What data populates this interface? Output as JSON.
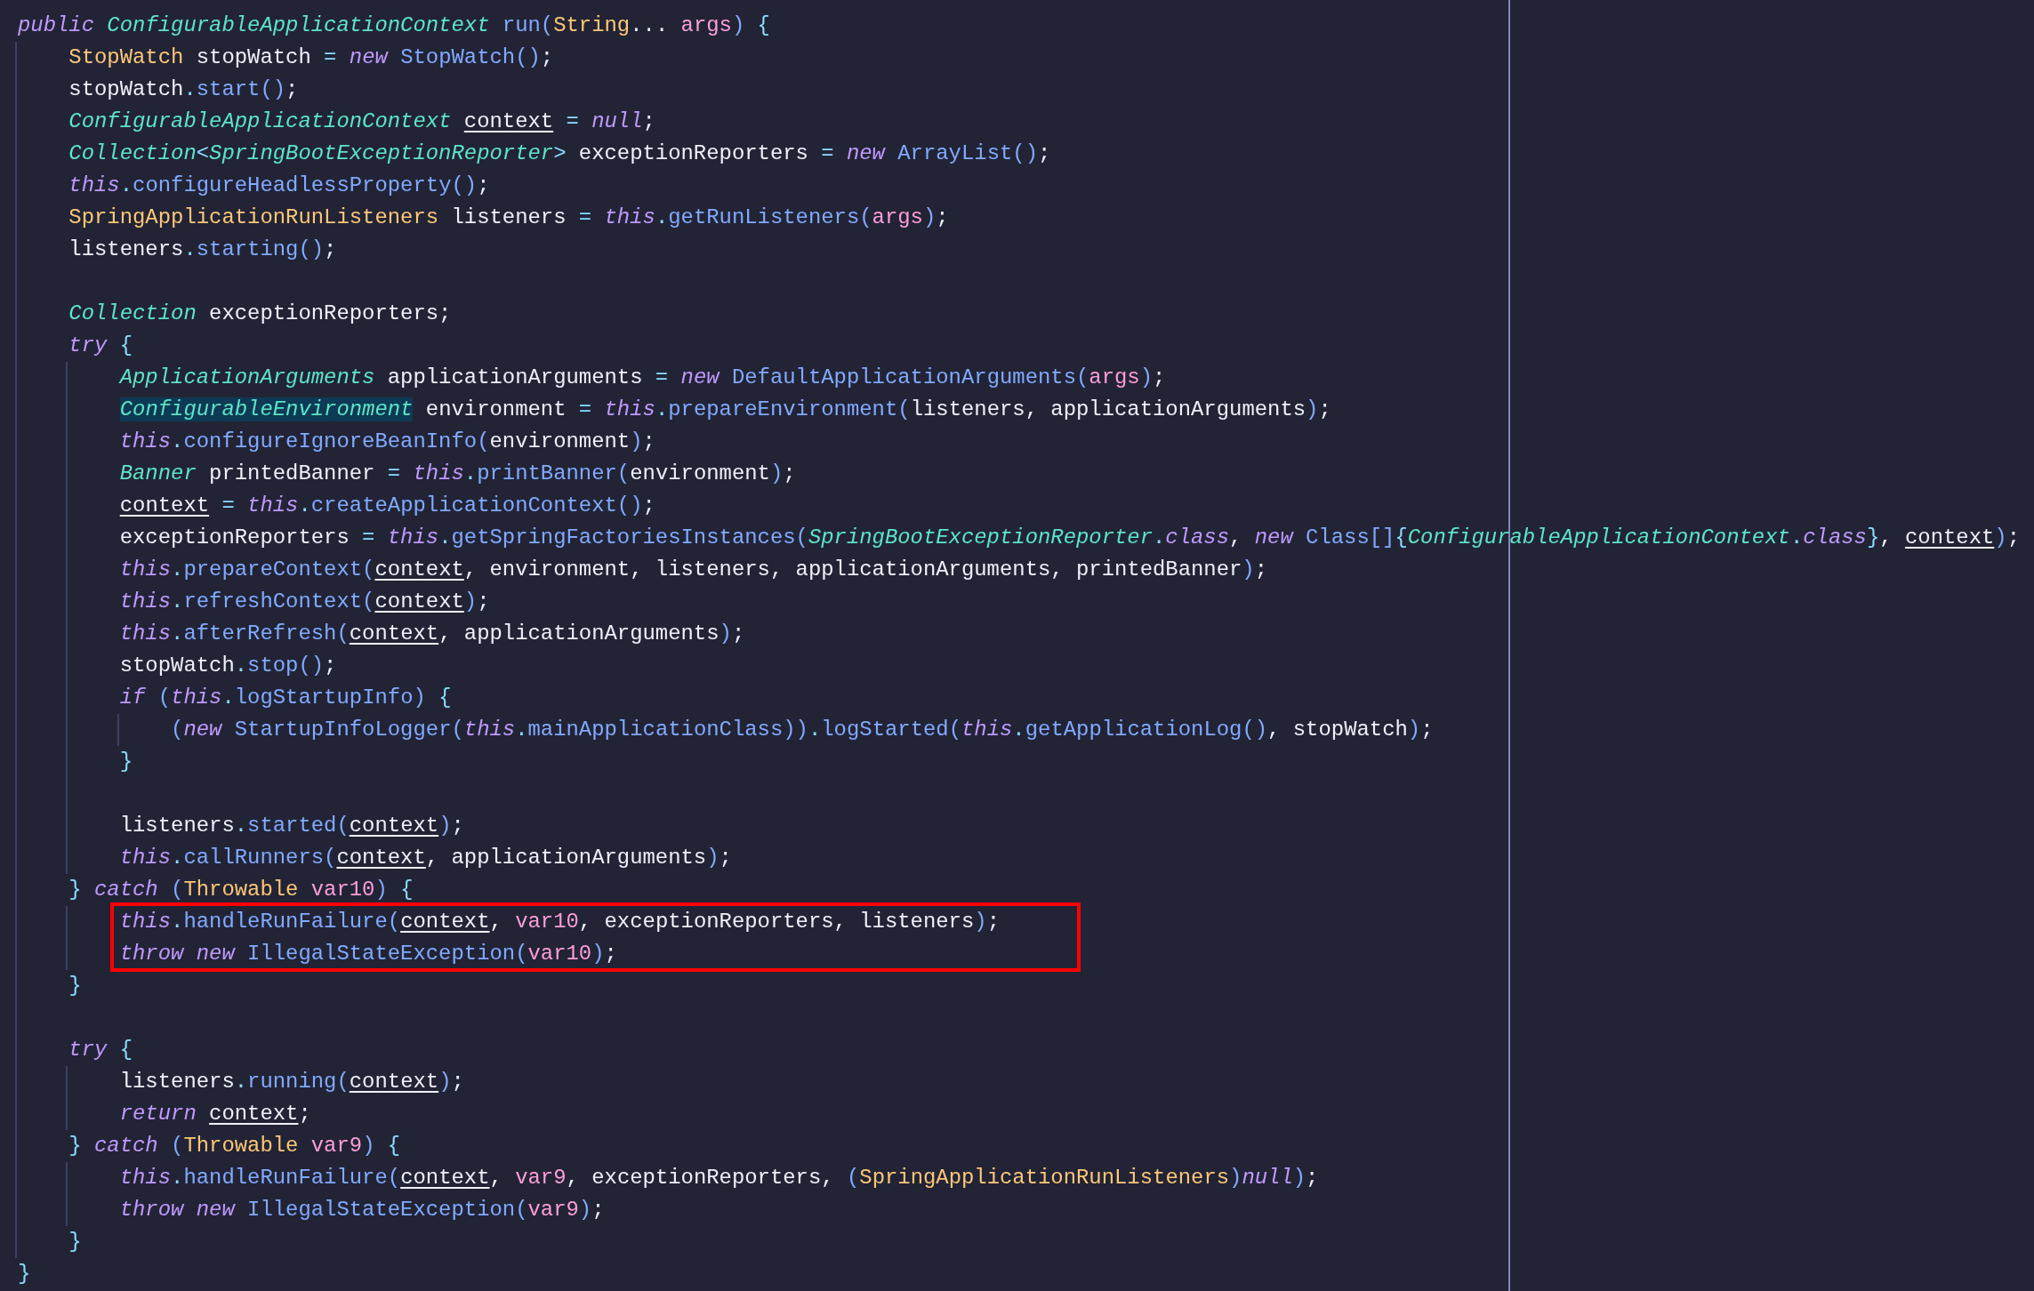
{
  "blocks": [
    {
      "boxed": false,
      "lines": [
        {
          "tokens": [
            {
              "kind": "kw",
              "text": "public"
            },
            {
              "kind": "it",
              "text": " ConfigurableApplicationContext"
            },
            {
              "kind": "fn",
              "text": " run("
            },
            {
              "kind": "type",
              "text": "String"
            },
            {
              "kind": "tx",
              "text": "... "
            },
            {
              "kind": "var",
              "text": "args"
            },
            {
              "kind": "fn",
              "text": ")"
            },
            {
              "kind": "op",
              "text": " {"
            }
          ]
        },
        {
          "tokens": [
            {
              "kind": "type",
              "text": "    StopWatch"
            },
            {
              "kind": "tx",
              "text": " stopWatch "
            },
            {
              "kind": "op",
              "text": "="
            },
            {
              "kind": "kw",
              "text": " new"
            },
            {
              "kind": "fn",
              "text": " StopWatch()"
            },
            {
              "kind": "tx",
              "text": ";"
            }
          ]
        },
        {
          "tokens": [
            {
              "kind": "tx",
              "text": "    stopWatch"
            },
            {
              "kind": "op",
              "text": "."
            },
            {
              "kind": "fn",
              "text": "start()"
            },
            {
              "kind": "tx",
              "text": ";"
            }
          ]
        },
        {
          "tokens": [
            {
              "kind": "it",
              "text": "    ConfigurableApplicationContext"
            },
            {
              "kind": "ref",
              "text": " context"
            },
            {
              "kind": "op",
              "text": " ="
            },
            {
              "kind": "kw",
              "text": " null"
            },
            {
              "kind": "tx",
              "text": ";"
            }
          ]
        },
        {
          "tokens": [
            {
              "kind": "it",
              "text": "    Collection"
            },
            {
              "kind": "op",
              "text": "<"
            },
            {
              "kind": "it",
              "text": "SpringBootExceptionReporter"
            },
            {
              "kind": "op",
              "text": ">"
            },
            {
              "kind": "tx",
              "text": " exceptionReporters "
            },
            {
              "kind": "op",
              "text": "="
            },
            {
              "kind": "kw",
              "text": " new"
            },
            {
              "kind": "fn",
              "text": " ArrayList()"
            },
            {
              "kind": "tx",
              "text": ";"
            }
          ]
        },
        {
          "tokens": [
            {
              "kind": "kw",
              "text": "    this"
            },
            {
              "kind": "op",
              "text": "."
            },
            {
              "kind": "fn",
              "text": "configureHeadlessProperty()"
            },
            {
              "kind": "tx",
              "text": ";"
            }
          ]
        },
        {
          "tokens": [
            {
              "kind": "type",
              "text": "    SpringApplicationRunListeners"
            },
            {
              "kind": "tx",
              "text": " listeners "
            },
            {
              "kind": "op",
              "text": "="
            },
            {
              "kind": "kw",
              "text": " this"
            },
            {
              "kind": "op",
              "text": "."
            },
            {
              "kind": "fn",
              "text": "getRunListeners("
            },
            {
              "kind": "var",
              "text": "args"
            },
            {
              "kind": "fn",
              "text": ")"
            },
            {
              "kind": "tx",
              "text": ";"
            }
          ]
        },
        {
          "tokens": [
            {
              "kind": "tx",
              "text": "    listeners"
            },
            {
              "kind": "op",
              "text": "."
            },
            {
              "kind": "fn",
              "text": "starting()"
            },
            {
              "kind": "tx",
              "text": ";"
            }
          ]
        },
        {
          "blank_before": true,
          "tokens": [
            {
              "kind": "it",
              "text": "    Collection"
            },
            {
              "kind": "tx",
              "text": " exceptionReporters;"
            }
          ]
        },
        {
          "tokens": [
            {
              "kind": "kw",
              "text": "    try"
            },
            {
              "kind": "op",
              "text": " {"
            }
          ]
        },
        {
          "tokens": [
            {
              "kind": "it",
              "text": "        ApplicationArguments"
            },
            {
              "kind": "tx",
              "text": " applicationArguments "
            },
            {
              "kind": "op",
              "text": "="
            },
            {
              "kind": "kw",
              "text": " new"
            },
            {
              "kind": "fn",
              "text": " DefaultApplicationArguments("
            },
            {
              "kind": "var",
              "text": "args"
            },
            {
              "kind": "fn",
              "text": ")"
            },
            {
              "kind": "tx",
              "text": ";"
            }
          ]
        },
        {
          "tokens": [
            {
              "kind": "hl",
              "text": "        ConfigurableEnvironment"
            },
            {
              "kind": "tx",
              "text": " environment "
            },
            {
              "kind": "op",
              "text": "="
            },
            {
              "kind": "kw",
              "text": " this"
            },
            {
              "kind": "op",
              "text": "."
            },
            {
              "kind": "fn",
              "text": "prepareEnvironment("
            },
            {
              "kind": "tx",
              "text": "listeners, applicationArguments"
            },
            {
              "kind": "fn",
              "text": ")"
            },
            {
              "kind": "tx",
              "text": ";"
            }
          ]
        },
        {
          "tokens": [
            {
              "kind": "kw",
              "text": "        this"
            },
            {
              "kind": "op",
              "text": "."
            },
            {
              "kind": "fn",
              "text": "configureIgnoreBeanInfo("
            },
            {
              "kind": "tx",
              "text": "environment"
            },
            {
              "kind": "fn",
              "text": ")"
            },
            {
              "kind": "tx",
              "text": ";"
            }
          ]
        },
        {
          "tokens": [
            {
              "kind": "it",
              "text": "        Banner"
            },
            {
              "kind": "tx",
              "text": " printedBanner "
            },
            {
              "kind": "op",
              "text": "="
            },
            {
              "kind": "kw",
              "text": " this"
            },
            {
              "kind": "op",
              "text": "."
            },
            {
              "kind": "fn",
              "text": "printBanner("
            },
            {
              "kind": "tx",
              "text": "environment"
            },
            {
              "kind": "fn",
              "text": ")"
            },
            {
              "kind": "tx",
              "text": ";"
            }
          ]
        },
        {
          "tokens": [
            {
              "kind": "ref",
              "text": "        context"
            },
            {
              "kind": "op",
              "text": " ="
            },
            {
              "kind": "kw",
              "text": " this"
            },
            {
              "kind": "op",
              "text": "."
            },
            {
              "kind": "fn",
              "text": "createApplicationContext()"
            },
            {
              "kind": "tx",
              "text": ";"
            }
          ]
        },
        {
          "tokens": [
            {
              "kind": "tx",
              "text": "        exceptionReporters "
            },
            {
              "kind": "op",
              "text": "="
            },
            {
              "kind": "kw",
              "text": " this"
            },
            {
              "kind": "op",
              "text": "."
            },
            {
              "kind": "fn",
              "text": "getSpringFactoriesInstances("
            },
            {
              "kind": "it",
              "text": "SpringBootExceptionReporter"
            },
            {
              "kind": "op",
              "text": "."
            },
            {
              "kind": "kw",
              "text": "class"
            },
            {
              "kind": "tx",
              "text": ","
            },
            {
              "kind": "kw",
              "text": " new"
            },
            {
              "kind": "fn",
              "text": " Class[]"
            },
            {
              "kind": "op",
              "text": "{"
            },
            {
              "kind": "it",
              "text": "ConfigurableApplicationContext"
            },
            {
              "kind": "op",
              "text": "."
            },
            {
              "kind": "kw",
              "text": "class"
            },
            {
              "kind": "op",
              "text": "}"
            },
            {
              "kind": "tx",
              "text": ", "
            },
            {
              "kind": "ref",
              "text": "context"
            },
            {
              "kind": "fn",
              "text": ")"
            },
            {
              "kind": "tx",
              "text": ";"
            }
          ]
        },
        {
          "tokens": [
            {
              "kind": "kw",
              "text": "        this"
            },
            {
              "kind": "op",
              "text": "."
            },
            {
              "kind": "fn",
              "text": "prepareContext("
            },
            {
              "kind": "ref",
              "text": "context"
            },
            {
              "kind": "tx",
              "text": ", environment, listeners, applicationArguments, printedBanner"
            },
            {
              "kind": "fn",
              "text": ")"
            },
            {
              "kind": "tx",
              "text": ";"
            }
          ]
        },
        {
          "tokens": [
            {
              "kind": "kw",
              "text": "        this"
            },
            {
              "kind": "op",
              "text": "."
            },
            {
              "kind": "fn",
              "text": "refreshContext("
            },
            {
              "kind": "ref",
              "text": "context"
            },
            {
              "kind": "fn",
              "text": ")"
            },
            {
              "kind": "tx",
              "text": ";"
            }
          ]
        },
        {
          "tokens": [
            {
              "kind": "kw",
              "text": "        this"
            },
            {
              "kind": "op",
              "text": "."
            },
            {
              "kind": "fn",
              "text": "afterRefresh("
            },
            {
              "kind": "ref",
              "text": "context"
            },
            {
              "kind": "tx",
              "text": ", applicationArguments"
            },
            {
              "kind": "fn",
              "text": ")"
            },
            {
              "kind": "tx",
              "text": ";"
            }
          ]
        },
        {
          "tokens": [
            {
              "kind": "tx",
              "text": "        stopWatch"
            },
            {
              "kind": "op",
              "text": "."
            },
            {
              "kind": "fn",
              "text": "stop()"
            },
            {
              "kind": "tx",
              "text": ";"
            }
          ]
        },
        {
          "tokens": [
            {
              "kind": "kw",
              "text": "        if"
            },
            {
              "kind": "fn",
              "text": " ("
            },
            {
              "kind": "kw",
              "text": "this"
            },
            {
              "kind": "op",
              "text": "."
            },
            {
              "kind": "fn",
              "text": "logStartupInfo)"
            },
            {
              "kind": "op",
              "text": " {"
            }
          ]
        },
        {
          "tokens": [
            {
              "kind": "fn",
              "text": "            ("
            },
            {
              "kind": "kw",
              "text": "new"
            },
            {
              "kind": "fn",
              "text": " StartupInfoLogger("
            },
            {
              "kind": "kw",
              "text": "this"
            },
            {
              "kind": "op",
              "text": "."
            },
            {
              "kind": "fn",
              "text": "mainApplicationClass))"
            },
            {
              "kind": "op",
              "text": "."
            },
            {
              "kind": "fn",
              "text": "logStarted("
            },
            {
              "kind": "kw",
              "text": "this"
            },
            {
              "kind": "op",
              "text": "."
            },
            {
              "kind": "fn",
              "text": "getApplicationLog()"
            },
            {
              "kind": "tx",
              "text": ", stopWatch"
            },
            {
              "kind": "fn",
              "text": ")"
            },
            {
              "kind": "tx",
              "text": ";"
            }
          ]
        },
        {
          "tokens": [
            {
              "kind": "op",
              "text": "        }"
            }
          ]
        },
        {
          "blank_before": true,
          "tokens": [
            {
              "kind": "tx",
              "text": "        listeners"
            },
            {
              "kind": "op",
              "text": "."
            },
            {
              "kind": "fn",
              "text": "started("
            },
            {
              "kind": "ref",
              "text": "context"
            },
            {
              "kind": "fn",
              "text": ")"
            },
            {
              "kind": "tx",
              "text": ";"
            }
          ]
        },
        {
          "tokens": [
            {
              "kind": "kw",
              "text": "        this"
            },
            {
              "kind": "op",
              "text": "."
            },
            {
              "kind": "fn",
              "text": "callRunners("
            },
            {
              "kind": "ref",
              "text": "context"
            },
            {
              "kind": "tx",
              "text": ", applicationArguments"
            },
            {
              "kind": "fn",
              "text": ")"
            },
            {
              "kind": "tx",
              "text": ";"
            }
          ]
        },
        {
          "tokens": [
            {
              "kind": "op",
              "text": "    }"
            },
            {
              "kind": "kw",
              "text": " catch"
            },
            {
              "kind": "fn",
              "text": " ("
            },
            {
              "kind": "type",
              "text": "Throwable"
            },
            {
              "kind": "var",
              "text": " var10"
            },
            {
              "kind": "fn",
              "text": ")"
            },
            {
              "kind": "op",
              "text": " {"
            }
          ]
        }
      ]
    },
    {
      "boxed": true,
      "lines": [
        {
          "tokens": [
            {
              "kind": "kw",
              "text": "        this"
            },
            {
              "kind": "op",
              "text": "."
            },
            {
              "kind": "fn",
              "text": "handleRunFailure("
            },
            {
              "kind": "ref",
              "text": "context"
            },
            {
              "kind": "tx",
              "text": ", "
            },
            {
              "kind": "var",
              "text": "var10"
            },
            {
              "kind": "tx",
              "text": ", exceptionReporters, listeners"
            },
            {
              "kind": "fn",
              "text": ")"
            },
            {
              "kind": "tx",
              "text": ";"
            }
          ]
        },
        {
          "tokens": [
            {
              "kind": "kw",
              "text": "        throw new"
            },
            {
              "kind": "fn",
              "text": " IllegalStateException("
            },
            {
              "kind": "var",
              "text": "var10"
            },
            {
              "kind": "fn",
              "text": ")"
            },
            {
              "kind": "tx",
              "text": ";"
            }
          ]
        }
      ]
    },
    {
      "boxed": false,
      "lines": [
        {
          "tokens": [
            {
              "kind": "op",
              "text": "    }"
            }
          ]
        },
        {
          "blank_before": true,
          "tokens": [
            {
              "kind": "kw",
              "text": "    try"
            },
            {
              "kind": "op",
              "text": " {"
            }
          ]
        },
        {
          "tokens": [
            {
              "kind": "tx",
              "text": "        listeners"
            },
            {
              "kind": "op",
              "text": "."
            },
            {
              "kind": "fn",
              "text": "running("
            },
            {
              "kind": "ref",
              "text": "context"
            },
            {
              "kind": "fn",
              "text": ")"
            },
            {
              "kind": "tx",
              "text": ";"
            }
          ]
        },
        {
          "tokens": [
            {
              "kind": "kw",
              "text": "        return"
            },
            {
              "kind": "ref",
              "text": " context"
            },
            {
              "kind": "tx",
              "text": ";"
            }
          ]
        },
        {
          "tokens": [
            {
              "kind": "op",
              "text": "    }"
            },
            {
              "kind": "kw",
              "text": " catch"
            },
            {
              "kind": "fn",
              "text": " ("
            },
            {
              "kind": "type",
              "text": "Throwable"
            },
            {
              "kind": "var",
              "text": " var9"
            },
            {
              "kind": "fn",
              "text": ")"
            },
            {
              "kind": "op",
              "text": " {"
            }
          ]
        },
        {
          "tokens": [
            {
              "kind": "kw",
              "text": "        this"
            },
            {
              "kind": "op",
              "text": "."
            },
            {
              "kind": "fn",
              "text": "handleRunFailure("
            },
            {
              "kind": "ref",
              "text": "context"
            },
            {
              "kind": "tx",
              "text": ", "
            },
            {
              "kind": "var",
              "text": "var9"
            },
            {
              "kind": "tx",
              "text": ", exceptionReporters, "
            },
            {
              "kind": "fn",
              "text": "("
            },
            {
              "kind": "type",
              "text": "SpringApplicationRunListeners"
            },
            {
              "kind": "fn",
              "text": ")"
            },
            {
              "kind": "kw",
              "text": "null"
            },
            {
              "kind": "fn",
              "text": ")"
            },
            {
              "kind": "tx",
              "text": ";"
            }
          ]
        },
        {
          "tokens": [
            {
              "kind": "kw",
              "text": "        throw new"
            },
            {
              "kind": "fn",
              "text": " IllegalStateException("
            },
            {
              "kind": "var",
              "text": "var9"
            },
            {
              "kind": "fn",
              "text": ")"
            },
            {
              "kind": "tx",
              "text": ";"
            }
          ]
        },
        {
          "tokens": [
            {
              "kind": "op",
              "text": "    }"
            }
          ]
        },
        {
          "tokens": [
            {
              "kind": "op",
              "text": "}"
            }
          ]
        }
      ]
    }
  ]
}
